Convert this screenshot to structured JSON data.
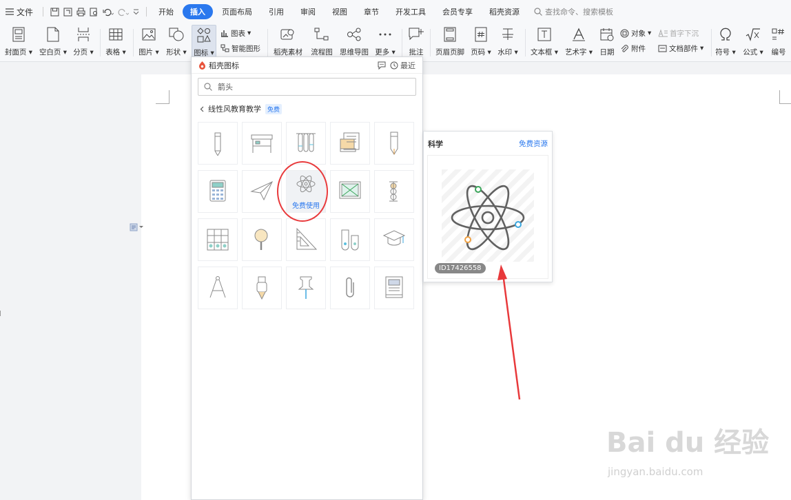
{
  "menubar": {
    "file": "文件",
    "tabs": [
      "开始",
      "插入",
      "页面布局",
      "引用",
      "审阅",
      "视图",
      "章节",
      "开发工具",
      "会员专享",
      "稻壳资源"
    ],
    "active_tab": 1,
    "search_placeholder": "查找命令、搜索模板"
  },
  "ribbon": {
    "cover": "封面页",
    "blank": "空白页",
    "pagebreak": "分页",
    "table": "表格",
    "picture": "图片",
    "shape": "形状",
    "icon": "图标",
    "chart": "图表",
    "smartart": "智能图形",
    "daoke": "稻壳素材",
    "flow": "流程图",
    "mindmap": "思维导图",
    "more": "更多",
    "comment": "批注",
    "header": "页眉页脚",
    "pagenum": "页码",
    "watermark": "水印",
    "textbox": "文本框",
    "wordart": "艺术字",
    "date": "日期",
    "object": "对象",
    "dropcap": "首字下沉",
    "attach": "附件",
    "docpart": "文档部件",
    "symbol": "符号",
    "formula": "公式",
    "numbering": "编号"
  },
  "panel": {
    "title": "稻壳图标",
    "recent": "最近",
    "search_value": "箭头",
    "breadcrumb": "线性风教育教学",
    "badge": "免费",
    "hover_label": "免费使用",
    "icons": [
      "pencil-icon",
      "desk-icon",
      "test-tubes-icon",
      "book-stack-icon",
      "pen-icon",
      "calculator-icon",
      "paper-plane-icon",
      "atom-icon",
      "chalkboard-icon",
      "abacus-icon",
      "bookshelf-icon",
      "magnifier-icon",
      "set-square-icon",
      "beakers-icon",
      "graduation-cap-icon",
      "compass-icon",
      "marker-icon",
      "pushpin-icon",
      "paperclip-icon",
      "textbook-icon"
    ]
  },
  "preview": {
    "title": "科学",
    "link": "免费资源",
    "id": "ID17426558"
  },
  "watermark": {
    "logo": "Bai du 经验",
    "url": "jingyan.baidu.com"
  },
  "colors": {
    "accent": "#2a78ee",
    "highlight_circle": "#e8393b",
    "arrow": "#e8393b"
  }
}
